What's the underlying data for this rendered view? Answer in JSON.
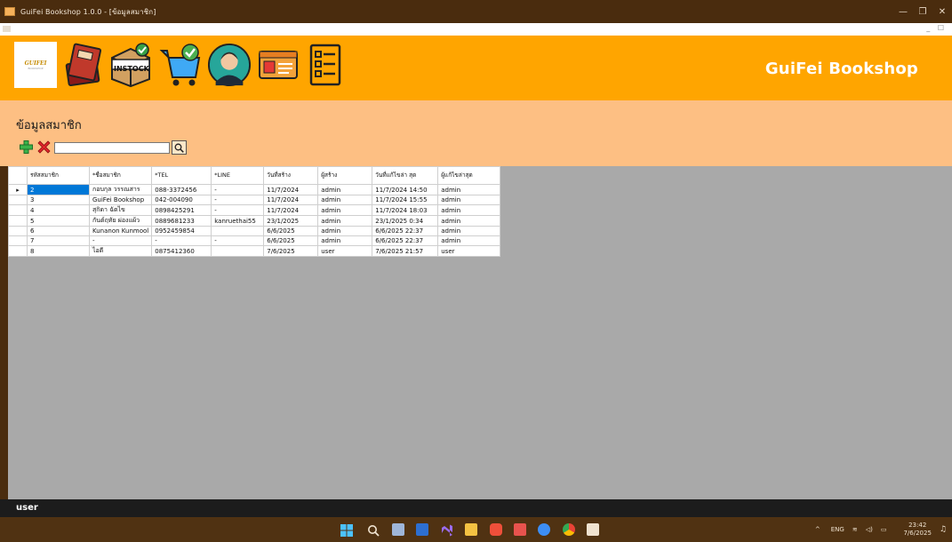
{
  "window": {
    "title": "GuiFei Bookshop 1.0.0 - [ข้อมูลสมาชิก]",
    "controls": {
      "minimize": "—",
      "restore": "❐",
      "close": "✕"
    }
  },
  "mdi": {
    "controls": "_ ☐"
  },
  "header": {
    "brand": "GuiFei Bookshop",
    "logo_text": "GUIFEI",
    "logo_sub": "BOOKSHOP",
    "instock_label": "INSTOCK",
    "colors": {
      "header_bg": "#ffa500",
      "subheader_bg": "#fdbf83"
    },
    "toolbar_icons": [
      "books-icon",
      "instock-box-icon",
      "cart-check-icon",
      "member-person-icon",
      "id-card-icon",
      "report-list-icon"
    ]
  },
  "page": {
    "title": "ข้อมูลสมาชิก"
  },
  "search": {
    "value": "",
    "placeholder": ""
  },
  "grid": {
    "columns": [
      "รหัสสมาชิก",
      "*ชื่อสมาชิก",
      "*TEL",
      "*LINE",
      "วันที่สร้าง",
      "ผู้สร้าง",
      "วันที่แก้ไขล่า สุด",
      "ผู้แก้ไขล่าสุด"
    ],
    "current_row_marker": "▸",
    "rows": [
      [
        "2",
        "กอบกุล วรรณสาร",
        "088-3372456",
        "-",
        "11/7/2024",
        "admin",
        "11/7/2024 14:50",
        "admin"
      ],
      [
        "3",
        "GuiFei Bookshop",
        "042-004090",
        "-",
        "11/7/2024",
        "admin",
        "11/7/2024 15:55",
        "admin"
      ],
      [
        "4",
        "สุกิดา ฉัตไข",
        "0898425291",
        "-",
        "11/7/2024",
        "admin",
        "11/7/2024 18:03",
        "admin"
      ],
      [
        "5",
        "กันต์ฤทัย ผ่องแผ้ว",
        "0889681233",
        "kanruethai55",
        "23/1/2025",
        "admin",
        "23/1/2025 0:34",
        "admin"
      ],
      [
        "6",
        "Kunanon Kunmool",
        "0952459854",
        "",
        "6/6/2025",
        "admin",
        "6/6/2025 22:37",
        "admin"
      ],
      [
        "7",
        "-",
        "-",
        "-",
        "6/6/2025",
        "admin",
        "6/6/2025 22:37",
        "admin"
      ],
      [
        "8",
        "ไอดี",
        "0875412360",
        "",
        "7/6/2025",
        "user",
        "7/6/2025 21:57",
        "user"
      ]
    ]
  },
  "status": {
    "user": "user"
  },
  "taskbar": {
    "apps": [
      "windows-start-icon",
      "search-icon",
      "task-view-icon",
      "store-icon",
      "visual-studio-icon",
      "file-explorer-icon",
      "brave-icon",
      "xampp-icon",
      "messenger-icon",
      "chrome-icon",
      "app-window-icon"
    ],
    "tray": {
      "chevron": "^",
      "lang": "ENG",
      "wifi": "≋",
      "sound": "◁)",
      "battery": "▭"
    },
    "time": "23:42",
    "date": "7/6/2025"
  }
}
